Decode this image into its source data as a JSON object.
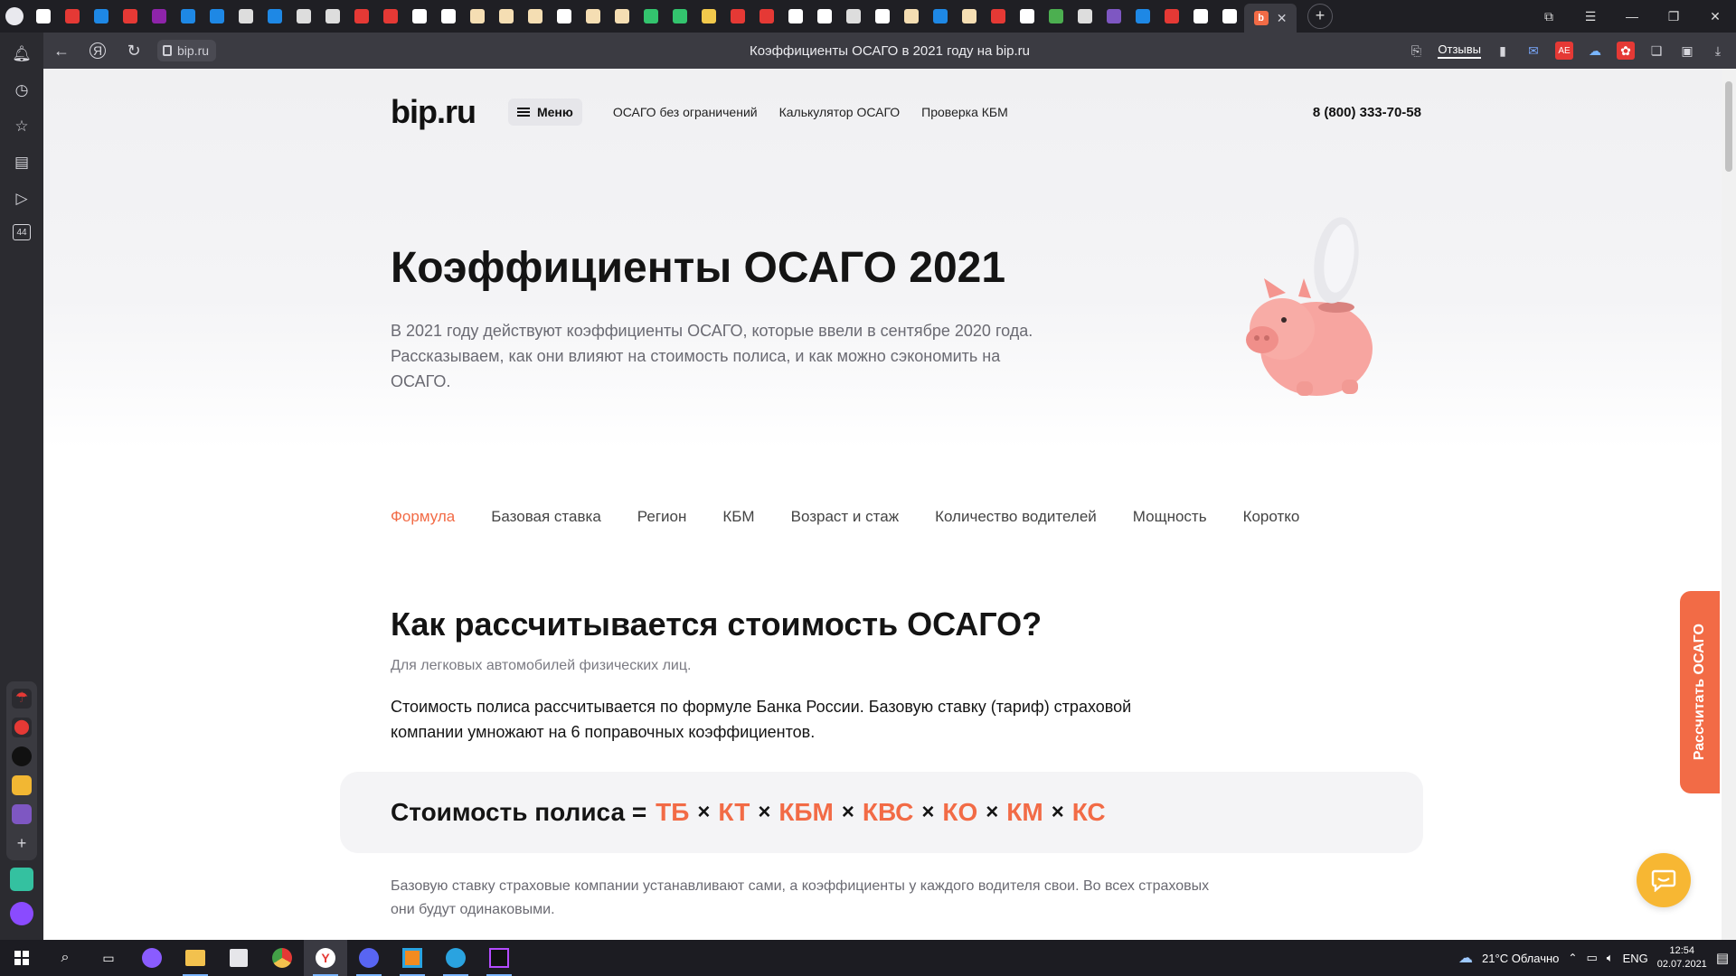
{
  "browser": {
    "tab_title": "Коэффициенты ОСАГО в 2021 году на bip.ru",
    "address": "bip.ru",
    "reviews_label": "Отзывы",
    "new_tab": "+",
    "active_tab_close": "✕",
    "tab_favicon_colors": [
      "#ffffff",
      "#e53935",
      "#1e88e5",
      "#e53935",
      "#8e24aa",
      "#1e88e5",
      "#1e88e5",
      "#dddddd",
      "#1e88e5",
      "#dddddd",
      "#dddddd",
      "#e53935",
      "#e53935",
      "#ffffff",
      "#ffffff",
      "#f5deb3",
      "#f5deb3",
      "#f5deb3",
      "#ffffff",
      "#f5deb3",
      "#f5deb3",
      "#33c46e",
      "#33c46e",
      "#f2c94c",
      "#e53935",
      "#e53935",
      "#ffffff",
      "#ffffff",
      "#dddddd",
      "#ffffff",
      "#f5deb3",
      "#1e88e5",
      "#f5deb3",
      "#e53935",
      "#ffffff",
      "#4caf50",
      "#dddddd",
      "#7e57c2",
      "#1e88e5",
      "#e53935",
      "#ffffff",
      "#ffffff"
    ]
  },
  "site": {
    "logo": "bip.ru",
    "menu_label": "Меню",
    "nav": [
      "ОСАГО без ограничений",
      "Калькулятор ОСАГО",
      "Проверка КБМ"
    ],
    "phone": "8 (800) 333-70-58"
  },
  "hero": {
    "title": "Коэффициенты ОСАГО 2021",
    "text": "В 2021 году действуют коэффициенты ОСАГО, которые ввели в сентябре 2020 года. Рассказываем, как они влияют на стоимость полиса, и как можно сэкономить на ОСАГО."
  },
  "anchors": [
    "Формула",
    "Базовая ставка",
    "Регион",
    "КБМ",
    "Возраст и стаж",
    "Количество водителей",
    "Мощность",
    "Коротко"
  ],
  "section": {
    "title": "Как рассчитывается стоимость ОСАГО?",
    "subtitle": "Для легковых автомобилей физических лиц.",
    "text": "Стоимость полиса рассчитывается по формуле Банка России. Базовую ставку (тариф) страховой компании умножают на 6 поправочных коэффициентов.",
    "formula_label": "Стоимость полиса =",
    "formula_terms": [
      "ТБ",
      "КТ",
      "КБМ",
      "КВС",
      "КО",
      "КМ",
      "КС"
    ],
    "formula_op": "×",
    "note": "Базовую ставку страховые компании устанавливают сами, а коэффициенты у каждого водителя свои. Во всех страховых они будут одинаковыми."
  },
  "side_cta": "Рассчитать ОСАГО",
  "sidebar": {
    "badge": "44"
  },
  "taskbar": {
    "weather": "21°C  Облачно",
    "lang": "ENG",
    "time": "12:54",
    "date": "02.07.2021"
  },
  "colors": {
    "accent": "#f26b46",
    "chat": "#f7b733"
  }
}
